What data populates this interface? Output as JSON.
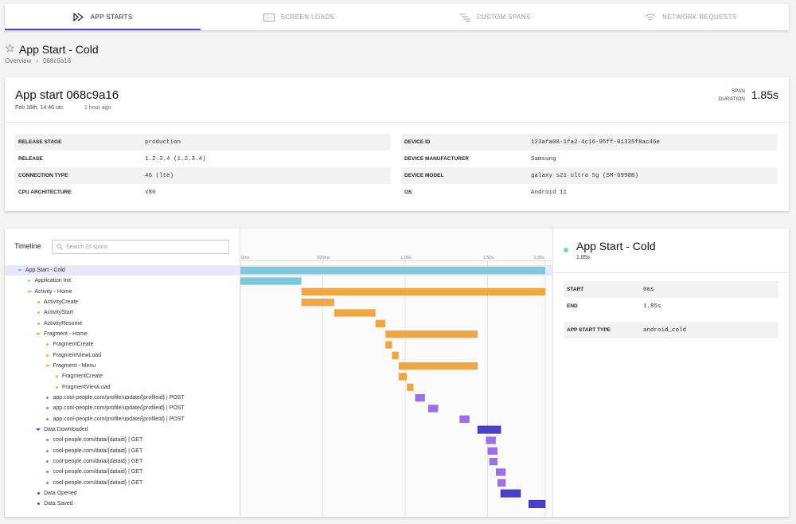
{
  "tabs": [
    {
      "label": "APP STARTS",
      "icon": "app-start-icon",
      "active": true
    },
    {
      "label": "SCREEN LOADS",
      "icon": "screen-icon",
      "active": false
    },
    {
      "label": "CUSTOM SPANS",
      "icon": "spans-icon",
      "active": false
    },
    {
      "label": "NETWORK REQUESTS",
      "icon": "wifi-icon",
      "active": false
    }
  ],
  "page": {
    "title": "App Start - Cold",
    "breadcrumb": [
      "Overview",
      "›",
      "068c9a16"
    ]
  },
  "summary": {
    "title": "App start 068c9a16",
    "date": "Feb 16th, 14:46 utc",
    "ago": "1 hour ago",
    "duration_label_1": "SPAN",
    "duration_label_2": "DURATION",
    "duration": "1.85s",
    "left_attrs": [
      {
        "k": "RELEASE STAGE",
        "v": "production"
      },
      {
        "k": "RELEASE",
        "v": "1.2.3.4 (1.2.3.4)"
      },
      {
        "k": "CONNECTION TYPE",
        "v": "4G (lte)"
      },
      {
        "k": "CPU ARCHITECTURE",
        "v": "x86"
      }
    ],
    "right_attrs": [
      {
        "k": "DEVICE ID",
        "v": "123afa08-1fa2-4c16-95ff-01335f8ac46e"
      },
      {
        "k": "DEVICE MANUFACTURER",
        "v": "Samsung"
      },
      {
        "k": "DEVICE MODEL",
        "v": "galaxy s21 ultra 5g (SM-G998B)"
      },
      {
        "k": "OS",
        "v": "Android 11"
      }
    ]
  },
  "timeline": {
    "label": "Timeline",
    "search_placeholder": "Search 23 spans",
    "axis_ticks": [
      "0ms",
      "500ms",
      "1.00s",
      "1.50s",
      "1.85s"
    ],
    "axis_values": [
      0,
      0.5,
      1.0,
      1.5,
      1.85
    ],
    "total": 1.85,
    "colors": {
      "root": "#7ec8dc",
      "orange": "#f0a742",
      "purple": "#9d6ee6",
      "blue": "#4a3fcf"
    },
    "spans": [
      {
        "name": "App Start - Cold",
        "depth": 0,
        "kind": "group",
        "color": "root",
        "start": 0.0,
        "end": 1.85,
        "selected": true
      },
      {
        "name": "Application Init",
        "depth": 1,
        "kind": "leaf",
        "color": "root",
        "start": 0.0,
        "end": 0.37
      },
      {
        "name": "Activity - Home",
        "depth": 1,
        "kind": "group",
        "color": "orange",
        "start": 0.37,
        "end": 1.85
      },
      {
        "name": "ActivityCreate",
        "depth": 2,
        "kind": "leaf",
        "color": "orange",
        "start": 0.37,
        "end": 0.57
      },
      {
        "name": "ActivityStart",
        "depth": 2,
        "kind": "leaf",
        "color": "orange",
        "start": 0.57,
        "end": 0.82
      },
      {
        "name": "ActivityResume",
        "depth": 2,
        "kind": "leaf",
        "color": "orange",
        "start": 0.82,
        "end": 0.88
      },
      {
        "name": "Fragment - Home",
        "depth": 2,
        "kind": "group",
        "color": "orange",
        "start": 0.88,
        "end": 1.44
      },
      {
        "name": "FragmentCreate",
        "depth": 3,
        "kind": "leaf",
        "color": "orange",
        "start": 0.88,
        "end": 0.92
      },
      {
        "name": "FragmentViewLoad",
        "depth": 3,
        "kind": "leaf",
        "color": "orange",
        "start": 0.92,
        "end": 0.96
      },
      {
        "name": "Fragment - Menu",
        "depth": 3,
        "kind": "group",
        "color": "orange",
        "start": 0.96,
        "end": 1.44
      },
      {
        "name": "FragmentCreate",
        "depth": 4,
        "kind": "leaf",
        "color": "orange",
        "start": 0.96,
        "end": 1.01
      },
      {
        "name": "FragmentViewLoad",
        "depth": 4,
        "kind": "leaf",
        "color": "orange",
        "start": 1.01,
        "end": 1.05
      },
      {
        "name": "app.cool-people.com/profile/update/{profileid} | POST",
        "depth": 3,
        "kind": "leaf",
        "color": "purple",
        "start": 1.06,
        "end": 1.12
      },
      {
        "name": "app.cool-people.com/profile/update/{profileid} | POST",
        "depth": 3,
        "kind": "leaf",
        "color": "purple",
        "start": 1.14,
        "end": 1.2
      },
      {
        "name": "app.cool-people.com/profile/update/{profileid} | POST",
        "depth": 3,
        "kind": "leaf",
        "color": "purple",
        "start": 1.33,
        "end": 1.39
      },
      {
        "name": "Data Downloaded",
        "depth": 2,
        "kind": "group",
        "color": "blue",
        "start": 1.44,
        "end": 1.58
      },
      {
        "name": "cool-people.com/data/{dataid} | GET",
        "depth": 3,
        "kind": "leaf",
        "color": "purple",
        "start": 1.49,
        "end": 1.55
      },
      {
        "name": "cool-people.com/data/{dataid} | GET",
        "depth": 3,
        "kind": "leaf",
        "color": "purple",
        "start": 1.5,
        "end": 1.56
      },
      {
        "name": "cool-people.com/data/{dataid} | GET",
        "depth": 3,
        "kind": "leaf",
        "color": "purple",
        "start": 1.51,
        "end": 1.56
      },
      {
        "name": "cool-people.com/data/{dataid} | GET",
        "depth": 3,
        "kind": "leaf",
        "color": "purple",
        "start": 1.55,
        "end": 1.61
      },
      {
        "name": "cool-people.com/data/{dataid} | GET",
        "depth": 3,
        "kind": "leaf",
        "color": "purple",
        "start": 1.56,
        "end": 1.61
      },
      {
        "name": "Data Opened",
        "depth": 2,
        "kind": "leaf",
        "color": "blue",
        "start": 1.58,
        "end": 1.7
      },
      {
        "name": "Data Saved",
        "depth": 2,
        "kind": "leaf",
        "color": "blue",
        "start": 1.75,
        "end": 1.85
      }
    ]
  },
  "detail": {
    "name": "App Start - Cold",
    "duration": "1.85s",
    "rows_a": [
      {
        "k": "START",
        "v": "0ms"
      },
      {
        "k": "END",
        "v": "1.85s"
      }
    ],
    "rows_b": [
      {
        "k": "APP START TYPE",
        "v": "android_cold"
      }
    ]
  }
}
